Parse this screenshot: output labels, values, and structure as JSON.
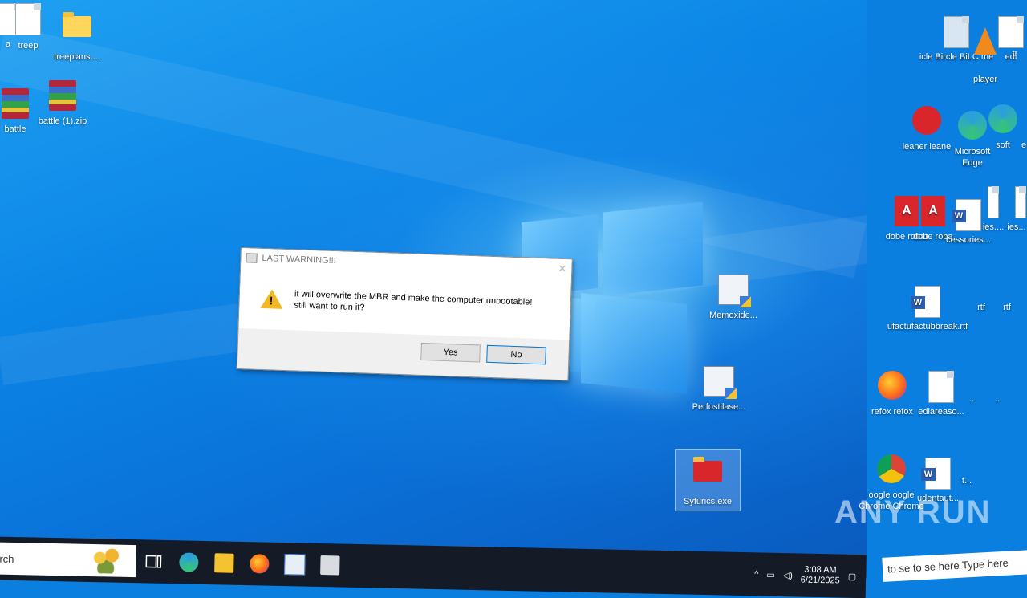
{
  "desktop_left": [
    {
      "label": "a",
      "icon": "document-icon"
    },
    {
      "label": "treep",
      "icon": "document-icon"
    },
    {
      "label": "treeplans....",
      "icon": "folder-icon"
    },
    {
      "label": "battle",
      "icon": "winrar-icon"
    },
    {
      "label": "battle (1).zip",
      "icon": "winrar-icon"
    }
  ],
  "desktop_center": [
    {
      "label": "Memoxide...",
      "icon": "installer-icon"
    },
    {
      "label": "Perfostilase...",
      "icon": "setup-icon"
    },
    {
      "label": "Syfurics.exe",
      "icon": "red-folder-exe-icon"
    }
  ],
  "desktop_right": [
    {
      "label": "icle Bircle BiLC me",
      "icon": "recycle-bin-icon"
    },
    {
      "label": "player",
      "icon": "vlc-icon"
    },
    {
      "label": "edi",
      "icon": "edit-icon"
    },
    {
      "label": "tr",
      "icon": "text-icon"
    },
    {
      "label": "leaner leane",
      "icon": "ccleaner-icon"
    },
    {
      "label": "Microsoft Edge",
      "icon": "edge-icon"
    },
    {
      "label": "soft",
      "icon": "edge-icon"
    },
    {
      "label": "e",
      "icon": "edge-icon"
    },
    {
      "label": "dobe robat",
      "icon": "acrobat-icon"
    },
    {
      "label": "dobe robat",
      "icon": "acrobat-icon"
    },
    {
      "label": "cessories...",
      "icon": "word-icon"
    },
    {
      "label": "ies....",
      "icon": "document-icon"
    },
    {
      "label": "ies...",
      "icon": "document-icon"
    },
    {
      "label": "ufactufactubbreak.rtf",
      "icon": "word-icon"
    },
    {
      "label": "rtf",
      "icon": "word-icon"
    },
    {
      "label": "rtf",
      "icon": "word-icon"
    },
    {
      "label": "refox refox",
      "icon": "firefox-icon"
    },
    {
      "label": "ediareaso...",
      "icon": "image-icon"
    },
    {
      "label": "..",
      "icon": "document-icon"
    },
    {
      "label": "..",
      "icon": "document-icon"
    },
    {
      "label": "oogle oogle",
      "icon": "chrome-icon"
    },
    {
      "label": "Chrome Chrome",
      "icon": "chrome-icon"
    },
    {
      "label": "udentaut...",
      "icon": "word-icon"
    },
    {
      "label": "t...",
      "icon": "document-icon"
    }
  ],
  "dialog": {
    "title": "LAST WARNING!!!",
    "message_line1": "it will overwrite the MBR and make the computer unbootable!",
    "message_line2": "still want to run it?",
    "yes_label": "Yes",
    "no_label": "No",
    "close_glyph": "✕"
  },
  "taskbar": {
    "search_text": "rch",
    "apps": [
      "task-view-icon",
      "edge-icon",
      "file-explorer-icon",
      "firefox-icon",
      "app-icon",
      "app2-icon"
    ],
    "time": "3:08 AM",
    "date": "6/21/2025",
    "tray_chevron": "^"
  },
  "overlay": {
    "watermark": "ANY RUN",
    "type_here": "Type here",
    "search_fragment": "to se to se",
    "here_fragment": "here"
  },
  "colors": {
    "desktop_blue": "#0a7fe0",
    "taskbar": "#141a26",
    "warning_yellow": "#f2b821"
  }
}
